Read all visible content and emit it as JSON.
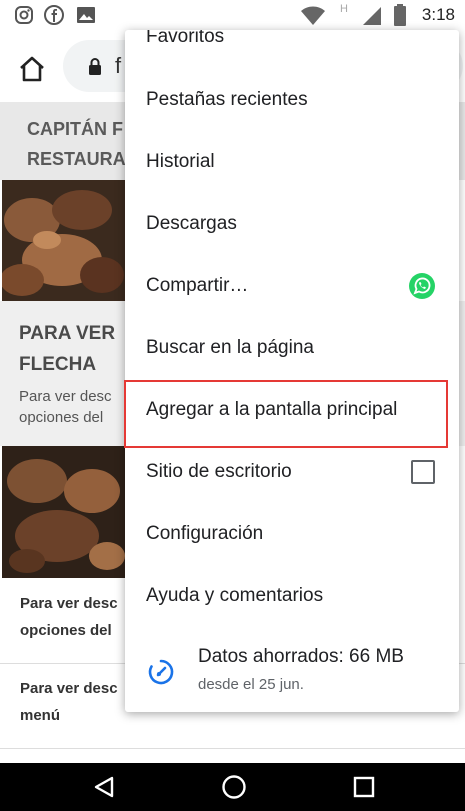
{
  "status_bar": {
    "time": "3:18",
    "left_icons": [
      "instagram-icon",
      "facebook-icon",
      "image-icon"
    ],
    "right_icons": [
      "wifi-icon",
      "signal-h-icon",
      "signal-icon",
      "battery-icon"
    ],
    "network_label": "H"
  },
  "address_bar": {
    "url_visible": "f"
  },
  "page": {
    "band_title": "CAPITÁN F\nRESTAURA",
    "card_title": "PARA VER\nFLECHA",
    "card_subtitle": "Para ver desc\nopciones del",
    "row1_text": "Para ver desc\nopciones del",
    "row2_text": "Para ver desc\nmenú"
  },
  "menu": {
    "partial_top": "Favoritos",
    "items": [
      {
        "label": "Pestañas recientes"
      },
      {
        "label": "Historial"
      },
      {
        "label": "Descargas"
      },
      {
        "label": "Compartir…"
      },
      {
        "label": "Buscar en la página"
      },
      {
        "label": "Agregar a la pantalla principal"
      },
      {
        "label": "Sitio de escritorio"
      },
      {
        "label": "Configuración"
      },
      {
        "label": "Ayuda y comentarios"
      }
    ],
    "data_saver": {
      "title": "Datos ahorrados: 66 MB",
      "subtitle": "desde el 25 jun."
    }
  },
  "nav_bar": {
    "icons": [
      "back-icon",
      "home-icon",
      "recents-icon"
    ]
  },
  "colors": {
    "highlight": "#e53935",
    "whatsapp": "#25d366",
    "data_saver_icon": "#1a73e8"
  }
}
